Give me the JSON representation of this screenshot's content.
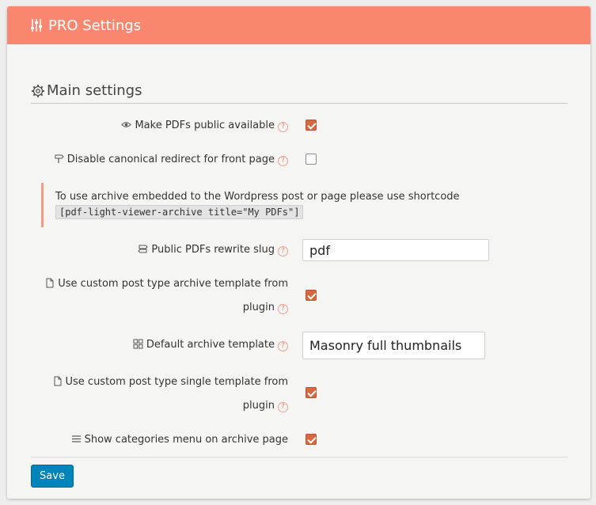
{
  "header": {
    "title": "PRO Settings",
    "icon": "sliders-icon",
    "color": "#f9866f"
  },
  "section": {
    "title": "Main settings",
    "icon": "gear-icon"
  },
  "settings": [
    {
      "label": "Make PDFs public available",
      "icon": "eye-icon",
      "help": "?",
      "checked": true
    },
    {
      "label": "Disable canonical redirect for front page",
      "icon": "signpost-icon",
      "help": "?",
      "checked": false
    },
    {
      "label": "Public PDFs rewrite slug",
      "icon": "signpost-icon",
      "help": "?",
      "value": "pdf"
    },
    {
      "label_line1": "Use custom post type archive template from",
      "label_line2": "plugin",
      "icon": "file-icon",
      "help": "?",
      "checked": true
    },
    {
      "label": "Default archive template",
      "icon": "grid-icon",
      "help": "?",
      "value": "Masonry full thumbnails"
    },
    {
      "label_line1": "Use custom post type single template from",
      "label_line2": "plugin",
      "icon": "file-icon",
      "help": "?",
      "checked": true
    },
    {
      "label": "Show categories menu on archive page",
      "icon": "menu-icon",
      "checked": true
    }
  ],
  "notice": {
    "text": "To use archive embedded to the Wordpress post or page please use shortcode",
    "code": "[pdf-light-viewer-archive title=\"My PDFs\"]"
  },
  "save_label": "Save",
  "colors": {
    "accent": "#d8683f",
    "button": "#0085ba"
  }
}
